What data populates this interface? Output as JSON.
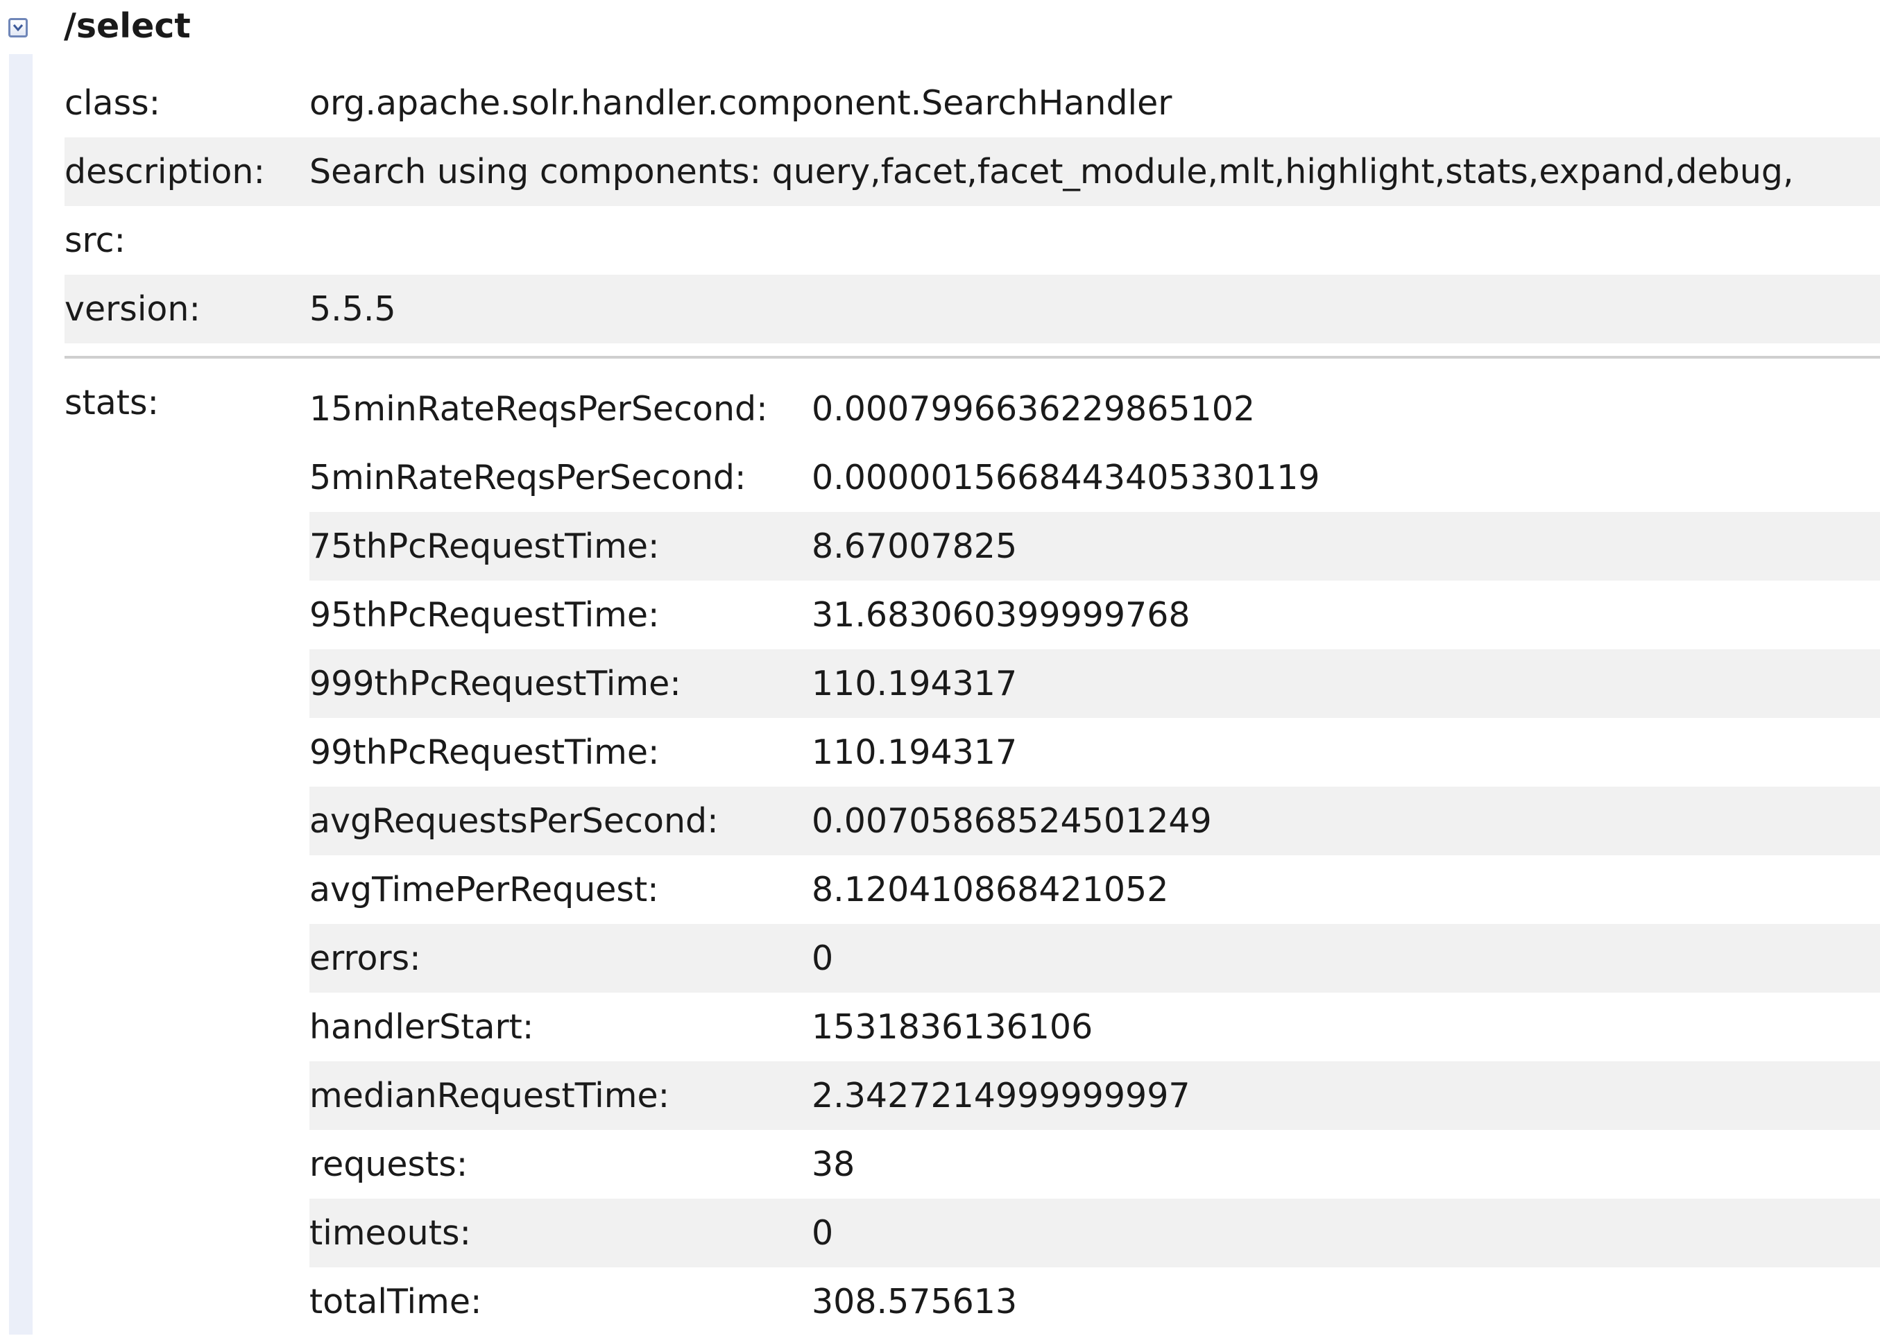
{
  "handler": {
    "name": "/select",
    "toggle_icon": "collapse-toggle-icon"
  },
  "properties": [
    {
      "key": "class:",
      "value": "org.apache.solr.handler.component.SearchHandler"
    },
    {
      "key": "description:",
      "value": "Search using components: query,facet,facet_module,mlt,highlight,stats,expand,debug,"
    },
    {
      "key": "src:",
      "value": ""
    },
    {
      "key": "version:",
      "value": "5.5.5"
    }
  ],
  "stats": {
    "label": "stats:",
    "items": [
      {
        "key": "15minRateReqsPerSecond:",
        "value": "0.0007996636229865102"
      },
      {
        "key": "5minRateReqsPerSecond:",
        "value": "0.0000015668443405330119"
      },
      {
        "key": "75thPcRequestTime:",
        "value": "8.67007825"
      },
      {
        "key": "95thPcRequestTime:",
        "value": "31.683060399999768"
      },
      {
        "key": "999thPcRequestTime:",
        "value": "110.194317"
      },
      {
        "key": "99thPcRequestTime:",
        "value": "110.194317"
      },
      {
        "key": "avgRequestsPerSecond:",
        "value": "0.00705868524501249"
      },
      {
        "key": "avgTimePerRequest:",
        "value": "8.120410868421052"
      },
      {
        "key": "errors:",
        "value": "0"
      },
      {
        "key": "handlerStart:",
        "value": "1531836136106"
      },
      {
        "key": "medianRequestTime:",
        "value": "2.3427214999999997"
      },
      {
        "key": "requests:",
        "value": "38"
      },
      {
        "key": "timeouts:",
        "value": "0"
      },
      {
        "key": "totalTime:",
        "value": "308.575613"
      }
    ]
  },
  "colors": {
    "row_shade": "#f1f1f1",
    "left_bar": "#ebeff9",
    "icon_border": "#6f86b8",
    "divider": "#cfcfcf"
  }
}
